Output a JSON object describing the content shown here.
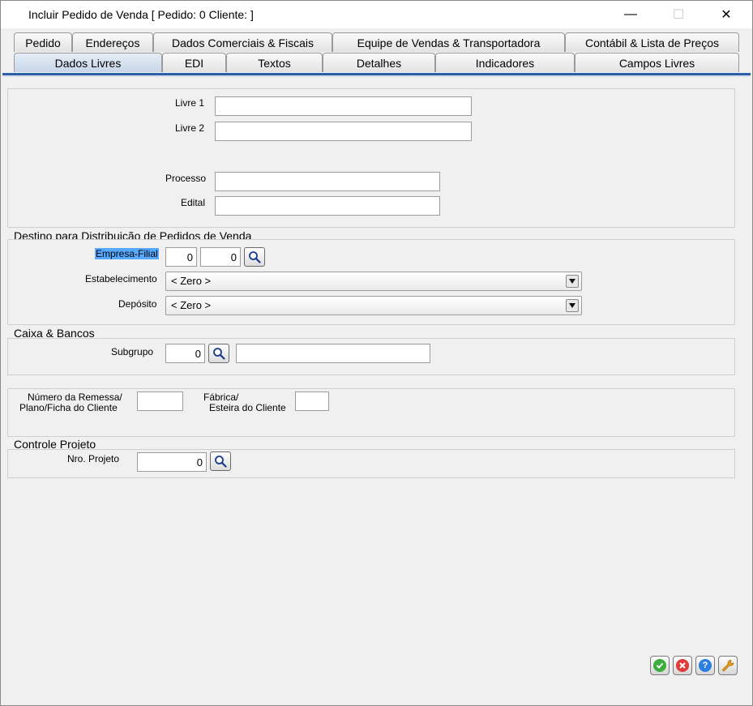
{
  "window": {
    "title": "Incluir Pedido de Venda [ Pedido: 0 Cliente: ]",
    "minimize": "—",
    "maximize": "☐",
    "close": "✕"
  },
  "tabs_row1": [
    {
      "label": "Pedido"
    },
    {
      "label": "Endereços"
    },
    {
      "label": "Dados Comerciais & Fiscais"
    },
    {
      "label": "Equipe de Vendas & Transportadora"
    },
    {
      "label": "Contábil & Lista de Preços"
    }
  ],
  "tabs_row2": [
    {
      "label": "Dados Livres",
      "active": true
    },
    {
      "label": "EDI"
    },
    {
      "label": "Textos"
    },
    {
      "label": "Detalhes"
    },
    {
      "label": "Indicadores"
    },
    {
      "label": "Campos Livres"
    }
  ],
  "livres": {
    "livre1_label": "Livre 1",
    "livre1_value": "",
    "livre2_label": "Livre 2",
    "livre2_value": "",
    "processo_label": "Processo",
    "processo_value": "",
    "edital_label": "Edital",
    "edital_value": ""
  },
  "destino": {
    "title": "Destino para Distribuição de Pedidos de Venda",
    "empresa_filial_label": "Empresa-Filial",
    "empresa_value": "0",
    "filial_value": "0",
    "estabelecimento_label": "Estabelecimento",
    "estabelecimento_value": "< Zero >",
    "deposito_label": "Depósito",
    "deposito_value": "< Zero >"
  },
  "caixa": {
    "title": "Caixa & Bancos",
    "subgrupo_label": "Subgrupo",
    "subgrupo_value": "0",
    "subgrupo_desc": ""
  },
  "remessa": {
    "numero_label_1": "Número da Remessa/",
    "numero_label_2": "Plano/Ficha do Cliente",
    "numero_value": "",
    "fabrica_label_1": "Fábrica/",
    "fabrica_label_2": "Esteira do Cliente",
    "fabrica_value": ""
  },
  "projeto": {
    "title": "Controle Projeto",
    "nro_label": "Nro. Projeto",
    "nro_value": "0"
  },
  "colors": {
    "tab_underline": "#2c5fa8",
    "highlight": "#55aaff",
    "ok": "#3cae3c",
    "cancel": "#e03a3a",
    "help": "#2a7fe0",
    "tools": "#f0a020"
  },
  "icons": {
    "lookup": "magnifier-icon",
    "ok": "check-icon",
    "cancel": "cancel-icon",
    "help": "help-icon",
    "tools": "wrench-icon"
  }
}
